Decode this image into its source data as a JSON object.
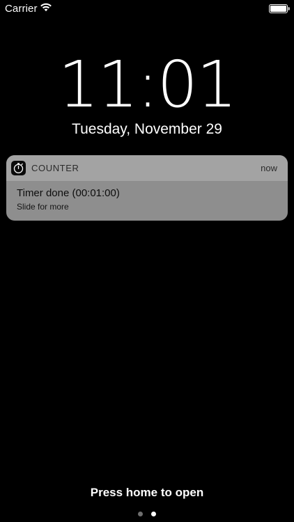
{
  "status_bar": {
    "carrier": "Carrier",
    "wifi_icon": "wifi-icon",
    "battery_icon": "battery-icon"
  },
  "lock_screen": {
    "time": "11:01",
    "date": "Tuesday, November 29"
  },
  "notification": {
    "app_icon": "stopwatch-icon",
    "app_name": "COUNTER",
    "time": "now",
    "title": "Timer done (00:01:00)",
    "subtitle": "Slide for more"
  },
  "footer": {
    "press_home": "Press home to open",
    "page_count": 2,
    "current_page": 2
  },
  "colors": {
    "background": "#000000",
    "notification_body": "#8e8e8e",
    "notification_header": "#a3a3a3",
    "dot_inactive": "#6e6e6e",
    "dot_active": "#ffffff"
  }
}
